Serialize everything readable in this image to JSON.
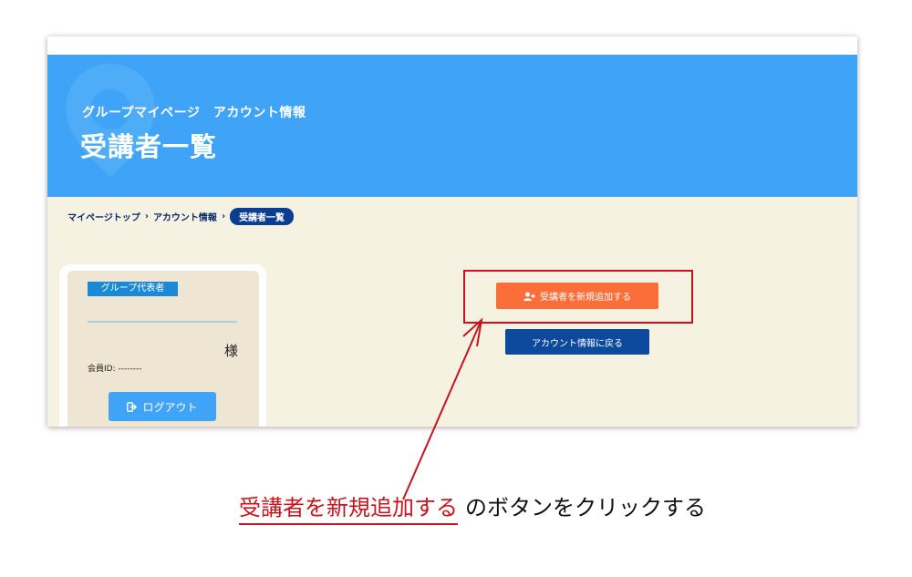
{
  "header": {
    "subtitle": "グループマイページ　アカウント情報",
    "title": "受講者一覧"
  },
  "breadcrumb": {
    "items": [
      "マイページトップ",
      "アカウント情報"
    ],
    "separator": "›",
    "current": "受講者一覧"
  },
  "profile_card": {
    "role_badge": "グループ代表者",
    "honorific": "様",
    "member_id_label": "会員ID:",
    "member_id_value": "--------",
    "logout_label": "ログアウト"
  },
  "actions": {
    "add_student_label": "受講者を新規追加する",
    "back_label": "アカウント情報に戻る"
  },
  "instruction": {
    "emphasis": "受講者を新規追加する",
    "rest": "のボタンをクリックする"
  },
  "colors": {
    "hero": "#3fa4f7",
    "page_bg": "#f6f2e2",
    "add_button": "#fb6e37",
    "back_button": "#0d4a9e",
    "annotation_red": "#c8131c"
  },
  "icons": {
    "add": "user-plus-icon",
    "logout": "sign-out-icon"
  }
}
